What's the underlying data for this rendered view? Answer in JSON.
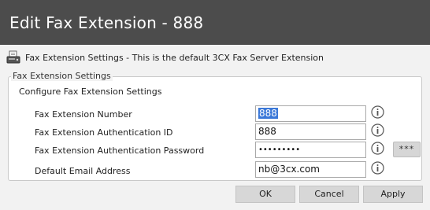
{
  "window": {
    "title": "Edit Fax Extension - 888"
  },
  "header": {
    "icon": "fax-icon",
    "text": "Fax Extension Settings - This is the default 3CX Fax Server Extension"
  },
  "panel": {
    "legend": "Fax Extension Settings",
    "subtitle": "Configure Fax Extension Settings",
    "fields": [
      {
        "label": "Fax Extension Number",
        "value": "888",
        "selected": true
      },
      {
        "label": "Fax Extension Authentication ID",
        "value": "888"
      },
      {
        "label": "Fax Extension Authentication Password",
        "value": "•••••••••"
      },
      {
        "label": "Default Email Address",
        "value": "nb@3cx.com"
      }
    ],
    "show_password_label": "***",
    "info_icon": "info-icon"
  },
  "buttons": {
    "ok": "OK",
    "cancel": "Cancel",
    "apply": "Apply"
  },
  "colors": {
    "titlebar": "#4c4c4c",
    "selection": "#3b78d8",
    "background": "#f2f2f2"
  }
}
